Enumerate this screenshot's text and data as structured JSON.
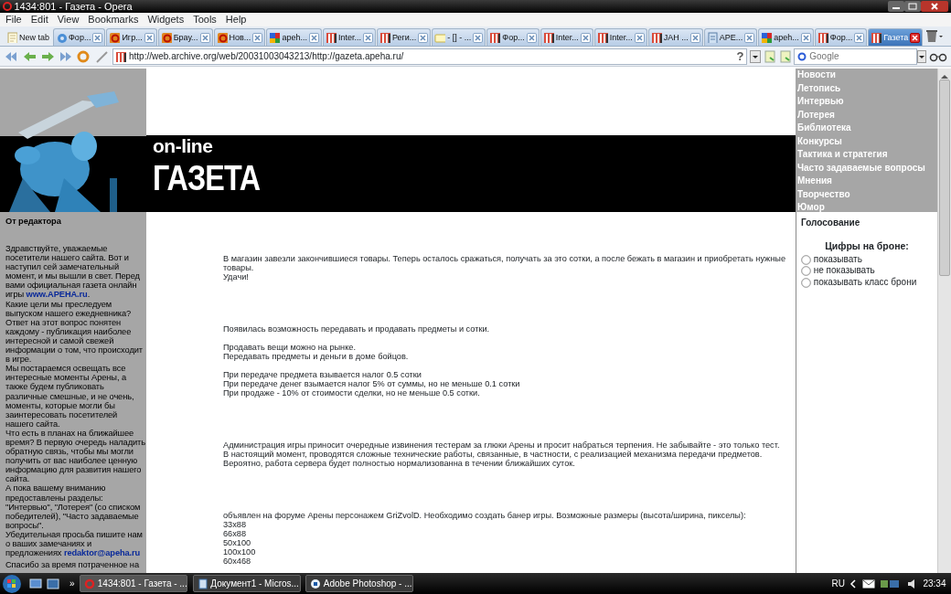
{
  "window": {
    "title": "1434:801 - Газета - Opera"
  },
  "menu": [
    "File",
    "Edit",
    "View",
    "Bookmarks",
    "Widgets",
    "Tools",
    "Help"
  ],
  "tabs": [
    {
      "label": "New tab",
      "kind": "blank",
      "selected": false
    },
    {
      "label": "Фор...",
      "kind": "gear",
      "selected": false
    },
    {
      "label": "Игр...",
      "kind": "opera",
      "selected": false
    },
    {
      "label": "Брау...",
      "kind": "opera",
      "selected": false
    },
    {
      "label": "Нов...",
      "kind": "opera",
      "selected": false
    },
    {
      "label": "apeh...",
      "kind": "google",
      "selected": false
    },
    {
      "label": "Inter...",
      "kind": "book",
      "selected": false
    },
    {
      "label": "Реги...",
      "kind": "book",
      "selected": false
    },
    {
      "label": "- [] - ...",
      "kind": "note",
      "selected": false
    },
    {
      "label": "Фор...",
      "kind": "book",
      "selected": false
    },
    {
      "label": "Inter...",
      "kind": "book",
      "selected": false
    },
    {
      "label": "Inter...",
      "kind": "book",
      "selected": false
    },
    {
      "label": "JAH ...",
      "kind": "book",
      "selected": false
    },
    {
      "label": "APE...",
      "kind": "scan",
      "selected": false
    },
    {
      "label": "apeh...",
      "kind": "google",
      "selected": false
    },
    {
      "label": "Фор...",
      "kind": "book",
      "selected": false
    },
    {
      "label": "Газета",
      "kind": "book",
      "selected": true
    }
  ],
  "address": {
    "url": "http://web.archive.org/web/20031003043213/http://gazeta.apeha.ru/",
    "help_glyph": "?"
  },
  "search": {
    "placeholder": "Google"
  },
  "page": {
    "sidebar": {
      "heading": "От редактора",
      "paragraphs": [
        {
          "text": "Здравствуйте, уважаемые посетители нашего сайта. Вот и наступил сей замечательный момент, и мы вышли в свет. Перед вами официальная газета онлайн игры ",
          "link": "www.APEHA.ru",
          "tail": "."
        },
        {
          "text": "Какие цели мы преследуем выпуском нашего ежедневника? Ответ на этот вопрос понятен каждому - публикация наиболее интересной и самой свежей информации о том, что происходит в игре."
        },
        {
          "text": "Мы постараемся освещать все интересные моменты Арены, а также будем публиковать различные смешные, и не очень, моменты, которые могли бы заинтересовать посетителей нашего сайта."
        },
        {
          "text": "Что есть в планах на ближайшее время? В первую очередь наладить обратную связь, чтобы мы могли получить от вас наиболее ценную информацию для развития нашего сайта."
        },
        {
          "text": "А пока вашему вниманию предоставлены разделы: \"Интервью\", \"Лотерея\" (со списком победителей), \"Часто задаваемые вопросы\"."
        },
        {
          "text": "Убедительная просьба пишите нам о ваших замечаниях и предложениях ",
          "link": "redaktor@apeha.ru"
        },
        {
          "text": "Спасибо за время потраченное на"
        }
      ]
    },
    "logo": {
      "line1": "on-line",
      "line2": "ГАЗЕТА"
    },
    "nav": [
      "Новости",
      "Летопись",
      "Интервью",
      "Лотерея",
      "Библиотека",
      "Конкурсы",
      "Тактика и стратегия",
      "Часто задаваемые вопросы",
      "Мнения",
      "Творчество",
      "Юмор"
    ],
    "poll": {
      "heading": "Голосование",
      "question": "Цифры на броне:",
      "options": [
        {
          "label": "показывать",
          "selected": false
        },
        {
          "label": "не показывать",
          "selected": false
        },
        {
          "label": "показывать класс брони",
          "selected": false
        }
      ]
    },
    "articles": [
      [
        [
          "В магазин завезли закончившиеся товары. Теперь осталось сражаться, получать за это сотки, а после бежать в магазин и приобретать нужные товары.",
          "Удачи!"
        ]
      ],
      [
        [
          "Появилась возможность передавать и продавать предметы и сотки."
        ],
        [
          "Продавать вещи можно на рынке.",
          "Передавать предметы и деньги в доме бойцов."
        ],
        [
          "При передаче предмета взывается налог 0.5 сотки",
          "При передаче денег взымается налог 5% от суммы, но не меньше 0.1 сотки",
          "При продаже - 10% от стоимости сделки, но не меньше 0.5 сотки."
        ]
      ],
      [
        [
          "Администрация игры приносит очередные извинения тестерам за глюки Арены и просит набраться терпения. Не забывайте - это только тест.",
          "В настоящий момент, проводятся сложные технические работы, связанные, в частности, с реализацией механизма передачи предметов.",
          "Вероятно, работа сервера будет полностью нормализованна в течении ближайших суток."
        ]
      ],
      [
        [
          "объявлен на форуме Арены персонажем GriZvolD. Необходимо создать банер игры. Возможные размеры (высота/ширина, пикселы):",
          "33x88",
          "66x88",
          "50x100",
          "100x100",
          "60x468"
        ]
      ]
    ]
  },
  "taskbar": {
    "more_glyph": "»",
    "tasks": [
      {
        "label": "1434:801 - Газета - ...",
        "kind": "opera",
        "selected": true
      },
      {
        "label": "Документ1 - Micros...",
        "kind": "word",
        "selected": false
      },
      {
        "label": "Adobe Photoshop - ...",
        "kind": "ps",
        "selected": false
      }
    ],
    "language": "RU",
    "clock": "23:34"
  }
}
